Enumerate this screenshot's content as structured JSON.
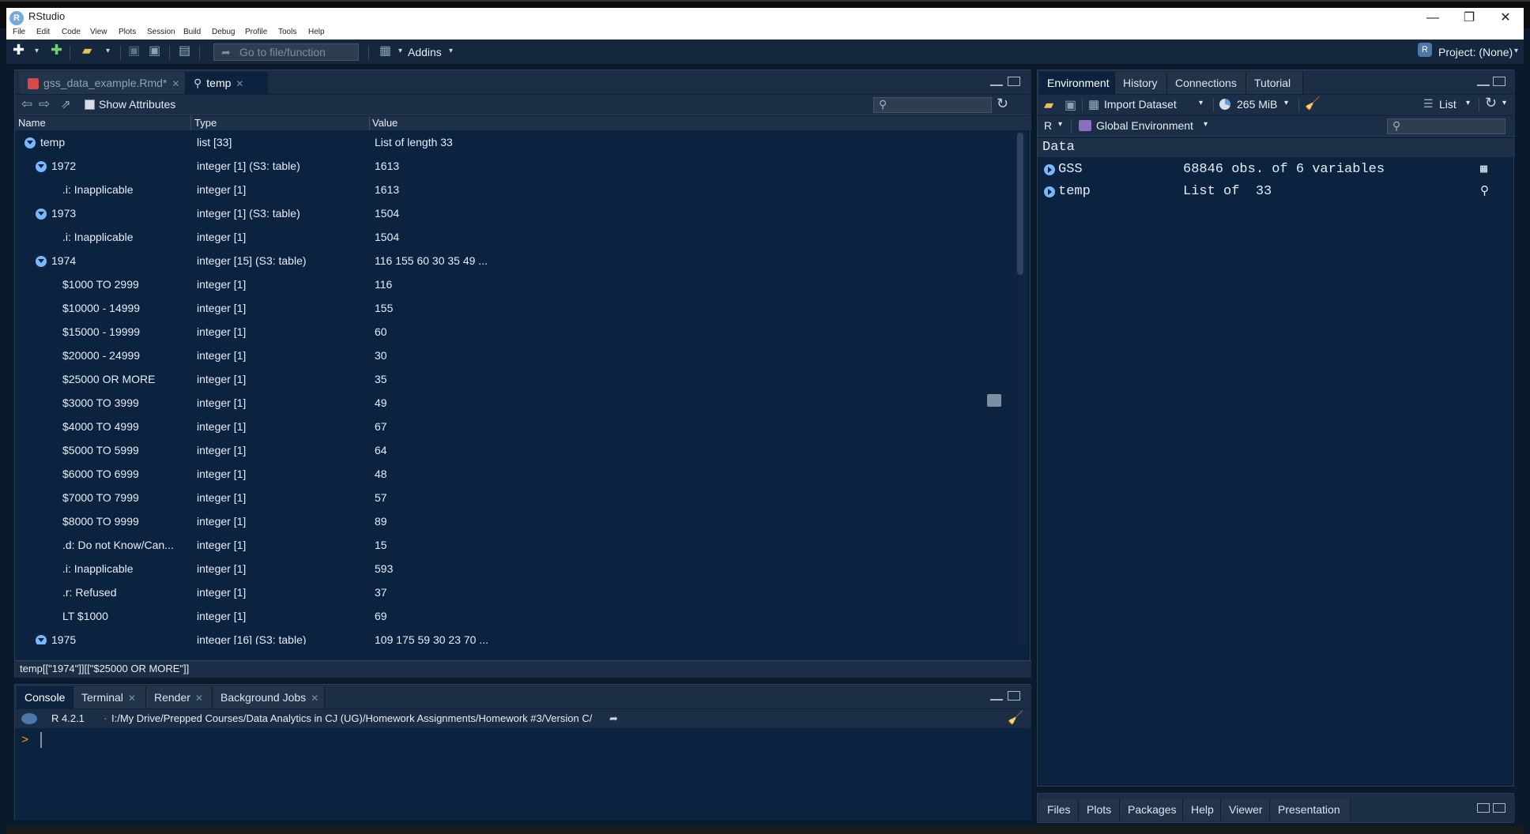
{
  "window": {
    "title": "RStudio",
    "controls": {
      "minimize": "—",
      "restore": "❐",
      "close": "✕"
    }
  },
  "menu": [
    "File",
    "Edit",
    "Code",
    "View",
    "Plots",
    "Session",
    "Build",
    "Debug",
    "Profile",
    "Tools",
    "Help"
  ],
  "toolbar": {
    "goto_placeholder": "Go to file/function",
    "addins_label": "Addins",
    "project_label": "Project: (None)"
  },
  "source_pane": {
    "tabs": [
      {
        "label": "gss_data_example.Rmd*",
        "active": false
      },
      {
        "label": "temp",
        "active": true
      }
    ],
    "show_attributes_label": "Show Attributes",
    "columns": {
      "name": "Name",
      "type": "Type",
      "value": "Value"
    },
    "rows": [
      {
        "name": "temp",
        "type": "list [33]",
        "value": "List of length 33",
        "level": 0,
        "expandable": true
      },
      {
        "name": "1972",
        "type": "integer [1] (S3: table)",
        "value": "1613",
        "level": 1,
        "expandable": true
      },
      {
        "name": ".i: Inapplicable",
        "type": "integer [1]",
        "value": "1613",
        "level": 2,
        "expandable": false
      },
      {
        "name": "1973",
        "type": "integer [1] (S3: table)",
        "value": "1504",
        "level": 1,
        "expandable": true
      },
      {
        "name": ".i: Inapplicable",
        "type": "integer [1]",
        "value": "1504",
        "level": 2,
        "expandable": false
      },
      {
        "name": "1974",
        "type": "integer [15] (S3: table)",
        "value": "116 155 60 30 35 49 ...",
        "level": 1,
        "expandable": true
      },
      {
        "name": "$1000 TO 2999",
        "type": "integer [1]",
        "value": "116",
        "level": 2,
        "expandable": false
      },
      {
        "name": "$10000 - 14999",
        "type": "integer [1]",
        "value": "155",
        "level": 2,
        "expandable": false
      },
      {
        "name": "$15000 - 19999",
        "type": "integer [1]",
        "value": "60",
        "level": 2,
        "expandable": false
      },
      {
        "name": "$20000 - 24999",
        "type": "integer [1]",
        "value": "30",
        "level": 2,
        "expandable": false
      },
      {
        "name": "$25000 OR MORE",
        "type": "integer [1]",
        "value": "35",
        "level": 2,
        "expandable": false
      },
      {
        "name": "$3000 TO 3999",
        "type": "integer [1]",
        "value": "49",
        "level": 2,
        "expandable": false
      },
      {
        "name": "$4000 TO 4999",
        "type": "integer [1]",
        "value": "67",
        "level": 2,
        "expandable": false
      },
      {
        "name": "$5000 TO 5999",
        "type": "integer [1]",
        "value": "64",
        "level": 2,
        "expandable": false
      },
      {
        "name": "$6000 TO 6999",
        "type": "integer [1]",
        "value": "48",
        "level": 2,
        "expandable": false
      },
      {
        "name": "$7000 TO 7999",
        "type": "integer [1]",
        "value": "57",
        "level": 2,
        "expandable": false
      },
      {
        "name": "$8000 TO 9999",
        "type": "integer [1]",
        "value": "89",
        "level": 2,
        "expandable": false
      },
      {
        "name": ".d: Do not Know/Can...",
        "type": "integer [1]",
        "value": "15",
        "level": 2,
        "expandable": false
      },
      {
        "name": ".i: Inapplicable",
        "type": "integer [1]",
        "value": "593",
        "level": 2,
        "expandable": false
      },
      {
        "name": ".r: Refused",
        "type": "integer [1]",
        "value": "37",
        "level": 2,
        "expandable": false
      },
      {
        "name": "LT $1000",
        "type": "integer [1]",
        "value": "69",
        "level": 2,
        "expandable": false
      },
      {
        "name": "1975",
        "type": "integer [16] (S3: table)",
        "value": "109 175 59 30 23 70 ...",
        "level": 1,
        "expandable": true
      }
    ],
    "path": "temp[[\"1974\"]][[\"$25000 OR MORE\"]]"
  },
  "console_pane": {
    "tabs": [
      "Console",
      "Terminal",
      "Render",
      "Background Jobs"
    ],
    "r_version": "R 4.2.1",
    "working_dir": "I:/My Drive/Prepped Courses/Data Analytics in CJ (UG)/Homework Assignments/Homework #3/Version C/",
    "prompt": ">"
  },
  "env_pane": {
    "tabs": [
      "Environment",
      "History",
      "Connections",
      "Tutorial"
    ],
    "import_label": "Import Dataset",
    "memory_label": "265 MiB",
    "view_mode": "List",
    "language": "R",
    "scope": "Global Environment",
    "section": "Data",
    "items": [
      {
        "name": "GSS",
        "desc": "68846 obs. of 6 variables"
      },
      {
        "name": "temp",
        "desc": "List of  33"
      }
    ]
  },
  "files_pane": {
    "tabs": [
      "Files",
      "Plots",
      "Packages",
      "Help",
      "Viewer",
      "Presentation"
    ]
  }
}
